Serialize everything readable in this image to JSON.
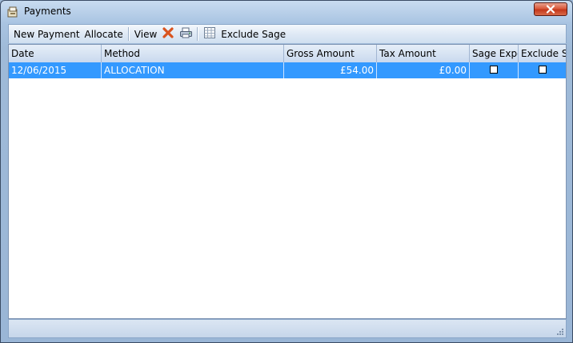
{
  "window": {
    "title": "Payments"
  },
  "toolbar": {
    "new_payment": "New Payment",
    "allocate": "Allocate",
    "view": "View",
    "exclude_sage": "Exclude Sage"
  },
  "grid": {
    "columns": [
      "Date",
      "Method",
      "Gross Amount",
      "Tax Amount",
      "Sage Expo",
      "Exclude S"
    ],
    "rows": [
      {
        "date": "12/06/2015",
        "method": "ALLOCATION",
        "gross": "£54.00",
        "tax": "£0.00",
        "sage_export": false,
        "exclude_sage": false
      }
    ]
  },
  "colors": {
    "selection": "#3399ff",
    "close_button": "#c3381b",
    "delete_icon": "#d9531e"
  },
  "icons": [
    "payments-window-icon",
    "close-icon",
    "delete-icon",
    "print-icon",
    "spreadsheet-icon",
    "resize-grip-icon"
  ]
}
